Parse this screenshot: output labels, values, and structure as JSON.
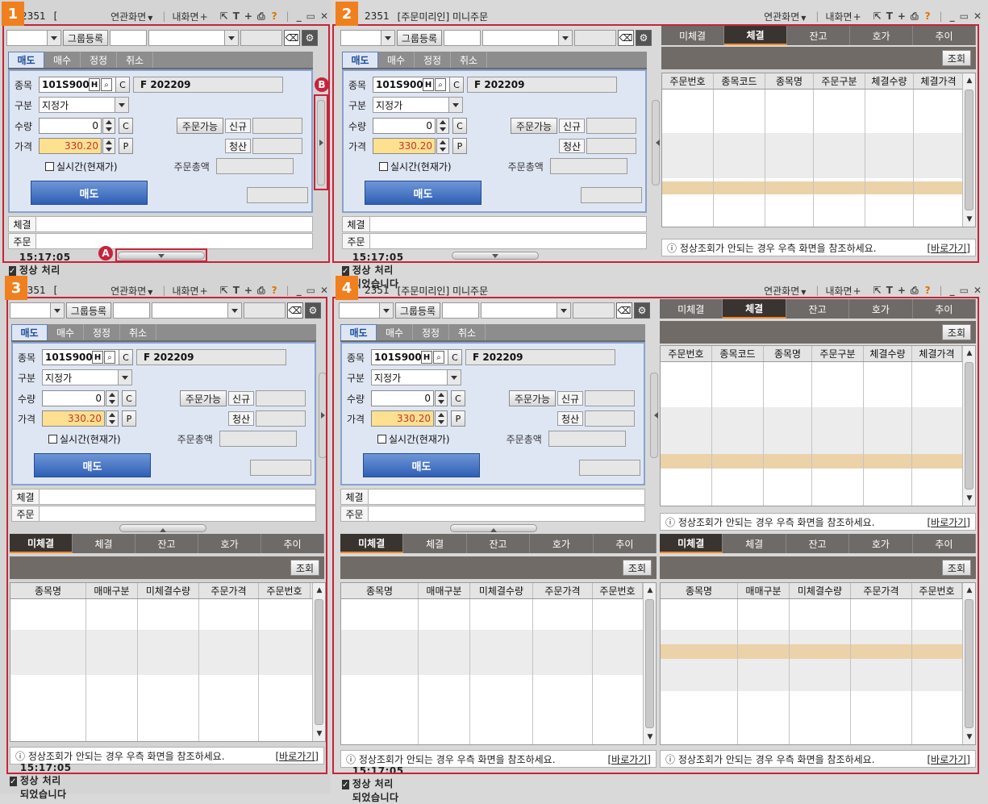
{
  "app": {
    "screen_no": "2351",
    "screen_name_short": "[",
    "screen_name": "[주문미리인] 미니주문",
    "menu1": "연관화면",
    "menu2": "내화면"
  },
  "panels": [
    "1",
    "2",
    "3",
    "4"
  ],
  "toolbar": {
    "group_btn": "그룹등록"
  },
  "order_tabs": [
    "매도",
    "매수",
    "정정",
    "취소"
  ],
  "form": {
    "code_label": "종목",
    "code": "101S9000",
    "code_name": "F 202209",
    "type_label": "구분",
    "type_value": "지정가",
    "qty_label": "수량",
    "qty": "0",
    "price_label": "가격",
    "price": "330.20",
    "c_label": "C",
    "p_label": "P",
    "avail_btn": "주문가능",
    "new_label": "신규",
    "liq_label": "청산",
    "realtime_label": "실시간(현재가)",
    "total_label": "주문총액",
    "sell_btn": "매도"
  },
  "summary": {
    "fill_label": "체결",
    "order_label": "주문"
  },
  "status": "15:17:05  정상 처리 되었습니다",
  "exec_tabs": [
    "미체결",
    "체결",
    "잔고",
    "호가",
    "추이"
  ],
  "query_btn": "조회",
  "fill_cols": [
    "주문번호",
    "종목코드",
    "종목명",
    "주문구분",
    "체결수량",
    "체결가격"
  ],
  "unfilled_cols": [
    "종목명",
    "매매구분",
    "미체결수량",
    "주문가격",
    "주문번호"
  ],
  "note": {
    "text": "ⓘ 정상조회가 안되는 경우 우측 화면을 참조하세요.",
    "link": "[바로가기]"
  },
  "marks": {
    "a": "A",
    "b": "B"
  },
  "colors": {
    "accent": "#f07f1e",
    "highlight": "#c8233a"
  }
}
